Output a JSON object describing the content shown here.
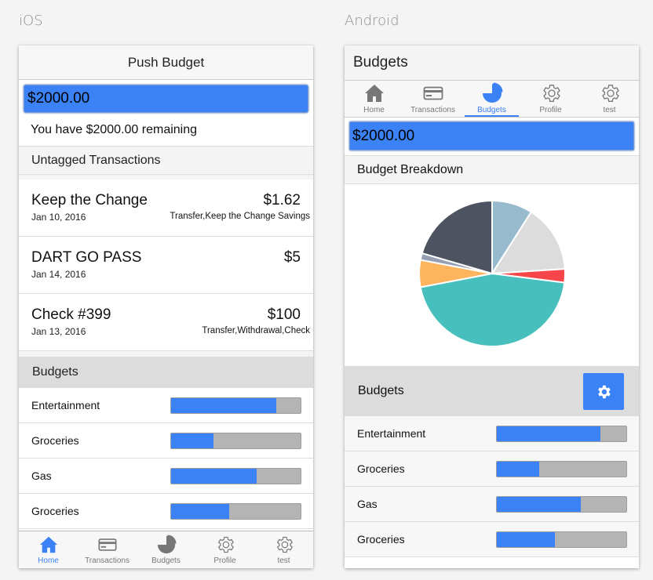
{
  "labels": {
    "ios": "iOS",
    "android": "Android"
  },
  "ios": {
    "header_title": "Push Budget",
    "amount_value": "$2000.00",
    "remaining_text": "You have $2000.00 remaining",
    "untagged_heading": "Untagged Transactions",
    "transactions": [
      {
        "name": "Keep the Change",
        "date": "Jan 10, 2016",
        "amount": "$1.62",
        "tags": "Transfer,Keep the Change Savings"
      },
      {
        "name": "DART GO PASS",
        "date": "Jan 14, 2016",
        "amount": "$5",
        "tags": ""
      },
      {
        "name": "Check #399",
        "date": "Jan 13, 2016",
        "amount": "$100",
        "tags": "Transfer,Withdrawal,Check"
      }
    ],
    "budgets_heading": "Budgets",
    "budgets": [
      {
        "label": "Entertainment",
        "fraction": 0.81
      },
      {
        "label": "Groceries",
        "fraction": 0.33
      },
      {
        "label": "Gas",
        "fraction": 0.66
      },
      {
        "label": "Groceries",
        "fraction": 0.45
      }
    ],
    "tabs": [
      {
        "label": "Home",
        "icon": "home-icon",
        "active": true
      },
      {
        "label": "Transactions",
        "icon": "card-icon",
        "active": false
      },
      {
        "label": "Budgets",
        "icon": "pie-icon",
        "active": false
      },
      {
        "label": "Profile",
        "icon": "gear-icon",
        "active": false
      },
      {
        "label": "test",
        "icon": "gear-icon",
        "active": false
      }
    ]
  },
  "android": {
    "title": "Budgets",
    "tabs": [
      {
        "label": "Home",
        "icon": "home-icon",
        "active": false
      },
      {
        "label": "Transactions",
        "icon": "card-icon",
        "active": false
      },
      {
        "label": "Budgets",
        "icon": "pie-icon",
        "active": true
      },
      {
        "label": "Profile",
        "icon": "gear-icon",
        "active": false
      },
      {
        "label": "test",
        "icon": "gear-icon",
        "active": false
      }
    ],
    "amount_value": "$2000.00",
    "breakdown_heading": "Budget Breakdown",
    "budgets_heading": "Budgets",
    "settings_icon": "gear-icon",
    "budgets": [
      {
        "label": "Entertainment",
        "fraction": 0.8
      },
      {
        "label": "Groceries",
        "fraction": 0.33
      },
      {
        "label": "Gas",
        "fraction": 0.65
      },
      {
        "label": "Groceries",
        "fraction": 0.45
      }
    ]
  },
  "chart_data": {
    "type": "pie",
    "values": [
      9,
      15,
      3,
      45,
      6,
      1.5,
      20.5
    ],
    "colors": [
      "#97bbcd",
      "#dcdcdc",
      "#f7464a",
      "#46bfbd",
      "#fdb45c",
      "#949fb1",
      "#4d5360"
    ]
  },
  "colors": {
    "accent": "#3b82f6",
    "track": "#b4b4b4"
  }
}
